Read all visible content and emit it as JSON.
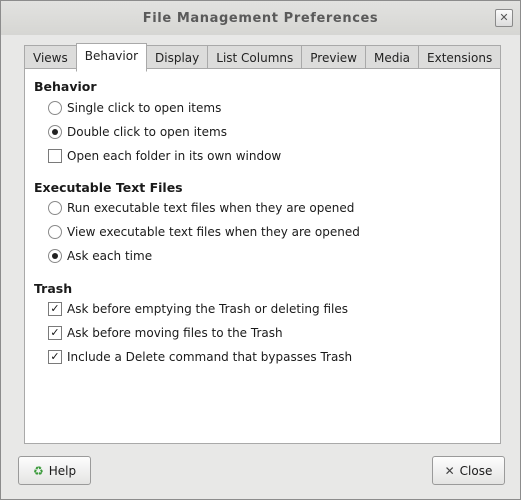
{
  "window": {
    "title": "File Management Preferences",
    "close_glyph": "✕"
  },
  "tabs": [
    {
      "label": "Views"
    },
    {
      "label": "Behavior"
    },
    {
      "label": "Display"
    },
    {
      "label": "List Columns"
    },
    {
      "label": "Preview"
    },
    {
      "label": "Media"
    },
    {
      "label": "Extensions"
    }
  ],
  "active_tab": "Behavior",
  "behavior": {
    "title": "Behavior",
    "single_click": "Single click to open items",
    "double_click": "Double click to open items",
    "own_window": "Open each folder in its own window"
  },
  "executable": {
    "title": "Executable Text Files",
    "run": "Run executable text files when they are opened",
    "view": "View executable text files when they are opened",
    "ask": "Ask each time"
  },
  "trash": {
    "title": "Trash",
    "ask_empty": "Ask before emptying the Trash or deleting files",
    "ask_move": "Ask before moving files to the Trash",
    "delete_cmd": "Include a Delete command that bypasses Trash"
  },
  "buttons": {
    "help": "Help",
    "close": "Close"
  },
  "icons": {
    "help": "help-icon",
    "close": "close-icon",
    "check": "✓",
    "help_glyph": "♻",
    "close_glyph": "✕"
  },
  "colors": {
    "arrow": "#e01b1b"
  }
}
